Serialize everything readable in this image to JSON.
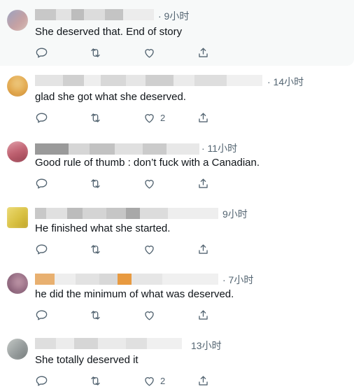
{
  "replies": [
    {
      "time": "· 9小时",
      "text": "She deserved that. End of story",
      "like_count": "",
      "avatar_colors": [
        "#8fa3c8",
        "#c9a0a0",
        "#d8d2c8"
      ]
    },
    {
      "time": "· 14小时",
      "text": "glad she got what she deserved.",
      "like_count": "2",
      "avatar_colors": [
        "#e0a040",
        "#f0d08a",
        "#a06a30"
      ]
    },
    {
      "time": "· 11小时",
      "text": "Good rule of thumb : don’t fuck with a Canadian.",
      "like_count": "",
      "avatar_colors": [
        "#c06070",
        "#8a3a48",
        "#e8b0b8"
      ]
    },
    {
      "time": "9小时",
      "text": "He finished what she started.",
      "like_count": "",
      "avatar_colors": [
        "#d8c040",
        "#f0e080",
        "#b89a20"
      ]
    },
    {
      "time": "· 7小时",
      "text": "he did the minimum of what was deserved.",
      "like_count": "",
      "avatar_colors": [
        "#8a6078",
        "#c8a0b0",
        "#5a3a50"
      ]
    },
    {
      "time": "13小时",
      "text": "She totally deserved it",
      "like_count": "2",
      "avatar_colors": [
        "#9aa0a0",
        "#d0d4d0",
        "#6a7070"
      ]
    }
  ],
  "icons": {
    "reply": "reply-icon",
    "retweet": "retweet-icon",
    "like": "heart-icon",
    "share": "share-icon"
  },
  "colors": {
    "text": "#0f1419",
    "muted": "#536471",
    "highlight_bg": "#f7f9f9"
  }
}
